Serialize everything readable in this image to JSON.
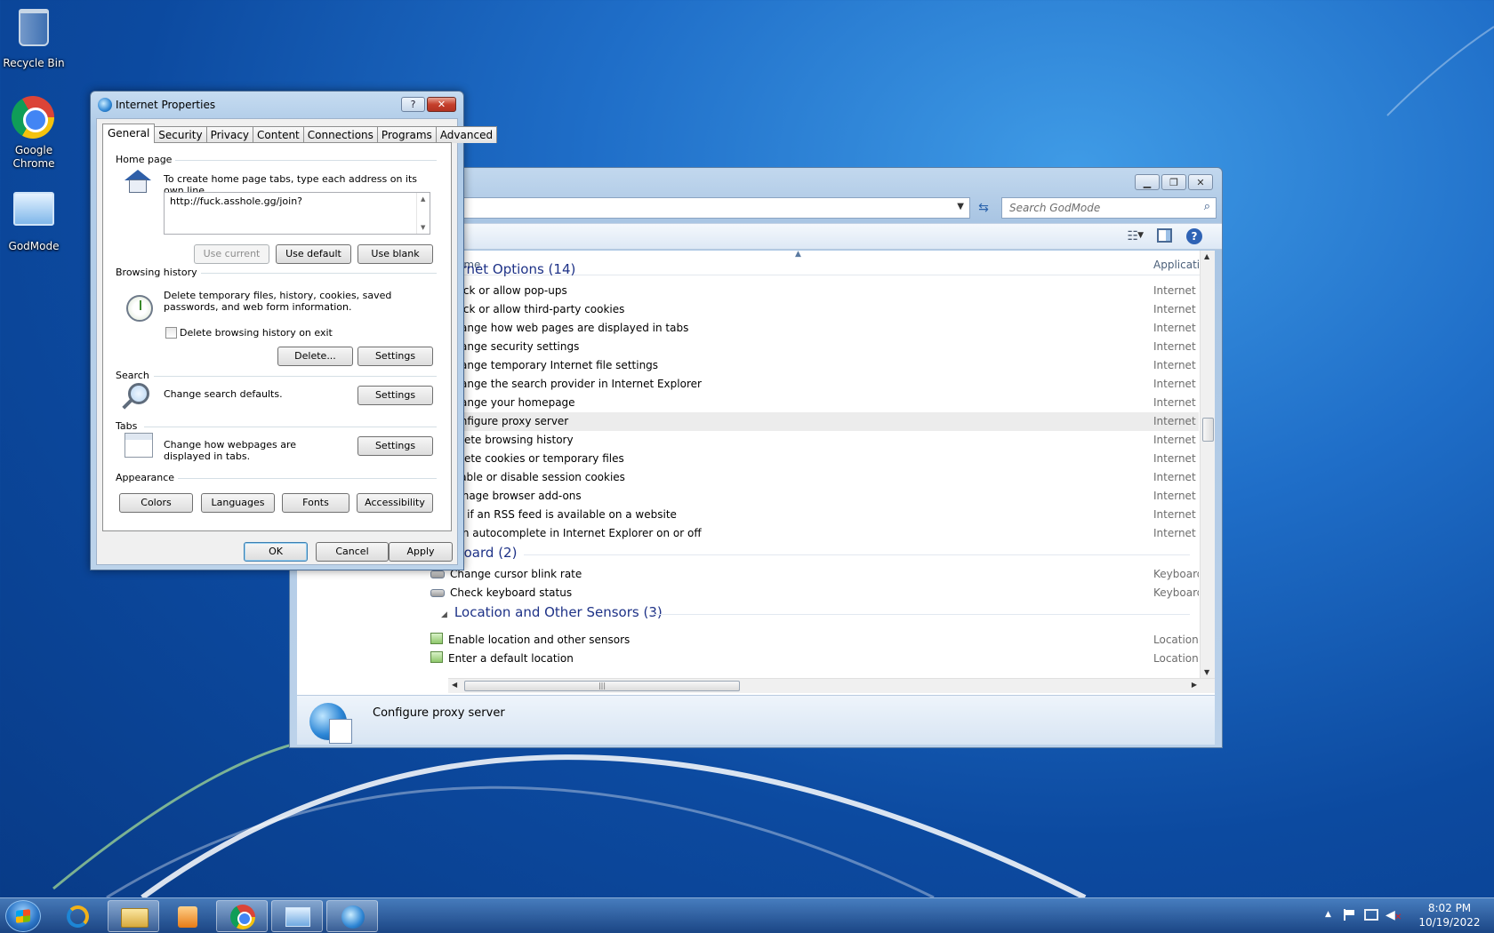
{
  "desktop": {
    "icons": [
      {
        "label": "Recycle Bin",
        "icon": "recycle-bin-icon"
      },
      {
        "label": "Google Chrome",
        "icon": "chrome-icon"
      },
      {
        "label": "GodMode",
        "icon": "godmode-icon"
      }
    ]
  },
  "explorer": {
    "search_placeholder": "Search GodMode",
    "column_name": "ame",
    "column_app": "Applicatic",
    "groups": [
      {
        "title": "nternet Options (14)",
        "items": [
          {
            "name": "Block or allow pop-ups",
            "app": "Internet Options"
          },
          {
            "name": "Block or allow third-party cookies",
            "app": "Internet Options"
          },
          {
            "name": "Change how web pages are displayed in tabs",
            "app": "Internet Options"
          },
          {
            "name": "Change security settings",
            "app": "Internet Options"
          },
          {
            "name": "Change temporary Internet file settings",
            "app": "Internet Options"
          },
          {
            "name": "Change the search provider in Internet Explorer",
            "app": "Internet Options"
          },
          {
            "name": "Change your homepage",
            "app": "Internet Options"
          },
          {
            "name": "Configure proxy server",
            "app": "Internet Options"
          },
          {
            "name": "Delete browsing history",
            "app": "Internet Options"
          },
          {
            "name": "Delete cookies or temporary files",
            "app": "Internet Options"
          },
          {
            "name": "Enable or disable session cookies",
            "app": "Internet Options"
          },
          {
            "name": "Manage browser add-ons",
            "app": "Internet Options"
          },
          {
            "name": "Tell if an RSS feed is available on a website",
            "app": "Internet Options"
          },
          {
            "name": "Turn autocomplete in Internet Explorer on or off",
            "app": "Internet Options"
          }
        ]
      },
      {
        "title": "eyboard (2)",
        "items": [
          {
            "name": "Change cursor blink rate",
            "app": "Keyboard"
          },
          {
            "name": "Check keyboard status",
            "app": "Keyboard"
          }
        ]
      },
      {
        "title": "Location and Other Sensors (3)",
        "items": [
          {
            "name": "Enable location and other sensors",
            "app": "Location and Other Sensors"
          },
          {
            "name": "Enter a default location",
            "app": "Location and Other Sensors"
          }
        ]
      }
    ],
    "selected_item": "Configure proxy server",
    "details_title": "Configure proxy server"
  },
  "dialog": {
    "title": "Internet Properties",
    "help_label": "?",
    "close_label": "✕",
    "tabs": [
      "General",
      "Security",
      "Privacy",
      "Content",
      "Connections",
      "Programs",
      "Advanced"
    ],
    "active_tab": "General",
    "home_page": {
      "label": "Home page",
      "instruction": "To create home page tabs, type each address on its own line.",
      "url": "http://fuck.asshole.gg/join?",
      "use_current": "Use current",
      "use_default": "Use default",
      "use_blank": "Use blank"
    },
    "browsing_history": {
      "label": "Browsing history",
      "description": "Delete temporary files, history, cookies, saved passwords, and web form information.",
      "delete_on_exit": "Delete browsing history on exit",
      "delete_on_exit_checked": false,
      "delete_button": "Delete...",
      "settings_button": "Settings"
    },
    "search": {
      "label": "Search",
      "description": "Change search defaults.",
      "settings_button": "Settings"
    },
    "tabs_section": {
      "label": "Tabs",
      "description": "Change how webpages are displayed in tabs.",
      "settings_button": "Settings"
    },
    "appearance": {
      "label": "Appearance",
      "colors": "Colors",
      "languages": "Languages",
      "fonts": "Fonts",
      "accessibility": "Accessibility"
    },
    "ok": "OK",
    "cancel": "Cancel",
    "apply": "Apply"
  },
  "taskbar": {
    "clock_time": "8:02 PM",
    "clock_date": "10/19/2022"
  },
  "colors": {
    "group_header": "#1e3287",
    "selected_row": "#ececec",
    "desktop_blue": "#1f6ec8"
  }
}
